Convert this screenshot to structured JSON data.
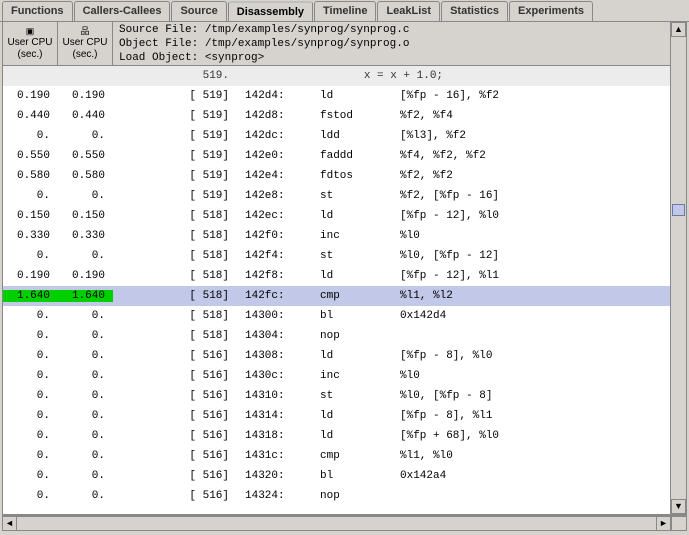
{
  "tabs": [
    {
      "label": "Functions",
      "active": false
    },
    {
      "label": "Callers-Callees",
      "active": false
    },
    {
      "label": "Source",
      "active": false
    },
    {
      "label": "Disassembly",
      "active": true
    },
    {
      "label": "Timeline",
      "active": false
    },
    {
      "label": "LeakList",
      "active": false
    },
    {
      "label": "Statistics",
      "active": false
    },
    {
      "label": "Experiments",
      "active": false
    }
  ],
  "columns": {
    "user_excl": {
      "icon": "▣",
      "l1": "User",
      "l2": "CPU",
      "l3": "(sec.)"
    },
    "user_incl": {
      "icon": "品",
      "l1": "User",
      "l2": "CPU",
      "l3": "(sec.)"
    }
  },
  "file_info": {
    "source": "Source File: /tmp/examples/synprog/synprog.c",
    "object": "Object File: /tmp/examples/synprog/synprog.o",
    "load": "Load Object: <synprog>"
  },
  "source_row": {
    "lineno": "519.",
    "text": "x = x + 1.0;"
  },
  "rows": [
    {
      "u1": "0.190",
      "u2": "0.190",
      "ln": "[ 519]",
      "addr": "142d4:",
      "instr": "ld",
      "ops": "[%fp - 16], %f2"
    },
    {
      "u1": "0.440",
      "u2": "0.440",
      "ln": "[ 519]",
      "addr": "142d8:",
      "instr": "fstod",
      "ops": "%f2, %f4"
    },
    {
      "u1": "0.",
      "u2": "0.",
      "ln": "[ 519]",
      "addr": "142dc:",
      "instr": "ldd",
      "ops": "[%l3], %f2"
    },
    {
      "u1": "0.550",
      "u2": "0.550",
      "ln": "[ 519]",
      "addr": "142e0:",
      "instr": "faddd",
      "ops": "%f4, %f2, %f2"
    },
    {
      "u1": "0.580",
      "u2": "0.580",
      "ln": "[ 519]",
      "addr": "142e4:",
      "instr": "fdtos",
      "ops": "%f2, %f2"
    },
    {
      "u1": "0.",
      "u2": "0.",
      "ln": "[ 519]",
      "addr": "142e8:",
      "instr": "st",
      "ops": "%f2, [%fp - 16]"
    },
    {
      "u1": "0.150",
      "u2": "0.150",
      "ln": "[ 518]",
      "addr": "142ec:",
      "instr": "ld",
      "ops": "[%fp - 12], %l0"
    },
    {
      "u1": "0.330",
      "u2": "0.330",
      "ln": "[ 518]",
      "addr": "142f0:",
      "instr": "inc",
      "ops": "%l0"
    },
    {
      "u1": "0.",
      "u2": "0.",
      "ln": "[ 518]",
      "addr": "142f4:",
      "instr": "st",
      "ops": "%l0, [%fp - 12]"
    },
    {
      "u1": "0.190",
      "u2": "0.190",
      "ln": "[ 518]",
      "addr": "142f8:",
      "instr": "ld",
      "ops": "[%fp - 12], %l1"
    },
    {
      "u1": "1.640",
      "u2": "1.640",
      "ln": "[ 518]",
      "addr": "142fc:",
      "instr": "cmp",
      "ops": "%l1, %l2",
      "hot": true,
      "hl": true
    },
    {
      "u1": "0.",
      "u2": "0.",
      "ln": "[ 518]",
      "addr": "14300:",
      "instr": "bl",
      "ops": "0x142d4"
    },
    {
      "u1": "0.",
      "u2": "0.",
      "ln": "[ 518]",
      "addr": "14304:",
      "instr": "nop",
      "ops": ""
    },
    {
      "u1": "0.",
      "u2": "0.",
      "ln": "[ 516]",
      "addr": "14308:",
      "instr": "ld",
      "ops": "[%fp - 8], %l0"
    },
    {
      "u1": "0.",
      "u2": "0.",
      "ln": "[ 516]",
      "addr": "1430c:",
      "instr": "inc",
      "ops": "%l0"
    },
    {
      "u1": "0.",
      "u2": "0.",
      "ln": "[ 516]",
      "addr": "14310:",
      "instr": "st",
      "ops": "%l0, [%fp - 8]"
    },
    {
      "u1": "0.",
      "u2": "0.",
      "ln": "[ 516]",
      "addr": "14314:",
      "instr": "ld",
      "ops": "[%fp - 8], %l1"
    },
    {
      "u1": "0.",
      "u2": "0.",
      "ln": "[ 516]",
      "addr": "14318:",
      "instr": "ld",
      "ops": "[%fp + 68], %l0"
    },
    {
      "u1": "0.",
      "u2": "0.",
      "ln": "[ 516]",
      "addr": "1431c:",
      "instr": "cmp",
      "ops": "%l1, %l0"
    },
    {
      "u1": "0.",
      "u2": "0.",
      "ln": "[ 516]",
      "addr": "14320:",
      "instr": "bl",
      "ops": "0x142a4"
    },
    {
      "u1": "0.",
      "u2": "0.",
      "ln": "[ 516]",
      "addr": "14324:",
      "instr": "nop",
      "ops": ""
    }
  ],
  "scroll": {
    "left_arrow": "◄",
    "right_arrow": "►",
    "up_arrow": "▲",
    "down_arrow": "▼"
  }
}
